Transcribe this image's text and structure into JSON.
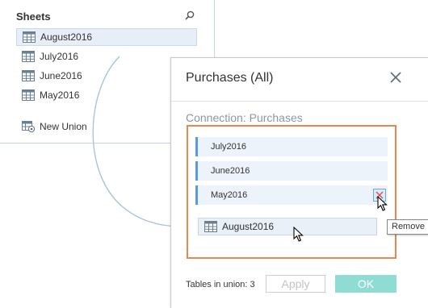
{
  "sheets": {
    "title": "Sheets",
    "items": [
      {
        "label": "August2016"
      },
      {
        "label": "July2016"
      },
      {
        "label": "June2016"
      },
      {
        "label": "May2016"
      }
    ],
    "new_union": "New Union"
  },
  "dialog": {
    "title": "Purchases (All)",
    "connection_label": "Connection: Purchases",
    "union_items": [
      {
        "label": "July2016"
      },
      {
        "label": "June2016"
      },
      {
        "label": "May2016"
      }
    ],
    "remove_tooltip": "Remove",
    "dragged_item": "August2016",
    "tables_label": "Tables in union:",
    "tables_count": "3",
    "apply_label": "Apply",
    "ok_label": "OK"
  },
  "colors": {
    "accent": "#5b9bd5",
    "drop_zone_border": "#e8874f",
    "ok_button": "#8fdcd2"
  }
}
